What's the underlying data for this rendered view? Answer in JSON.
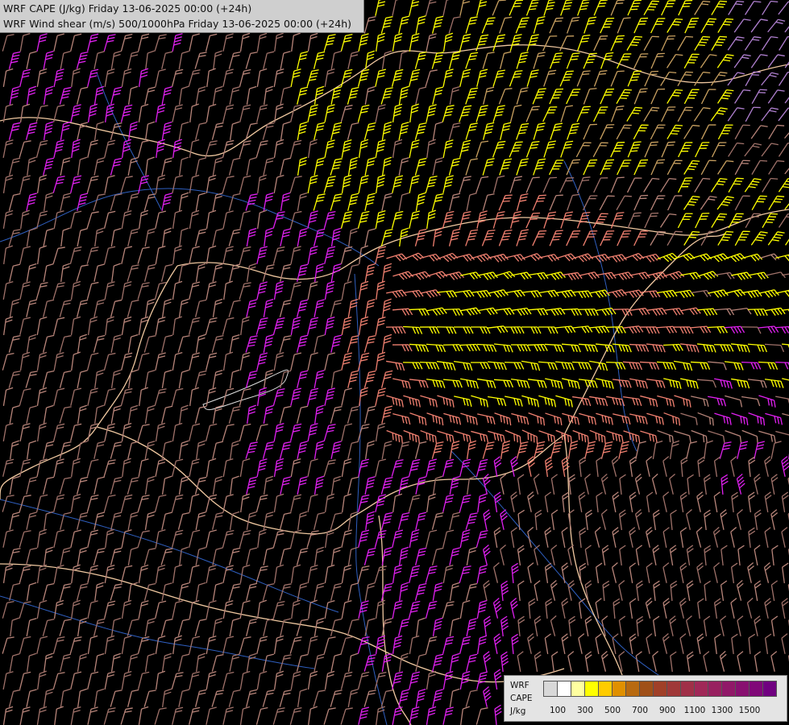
{
  "header": {
    "title_line1": "WRF CAPE (J/kg) Friday 13-06-2025 00:00 (+24h)",
    "title_line2": "WRF Wind shear (m/s) 500/1000hPa Friday 13-06-2025 00:00 (+24h)"
  },
  "legend": {
    "label_model": "WRF",
    "label_field": "CAPE",
    "label_unit": "J/kg",
    "colors": [
      "#d8d8d8",
      "#ffffff",
      "#ffffa0",
      "#ffff00",
      "#ffcc00",
      "#e09000",
      "#b86a10",
      "#a05018",
      "#a04028",
      "#a03838",
      "#a03048",
      "#a02858",
      "#982060",
      "#901868",
      "#881070",
      "#800878",
      "#700080"
    ],
    "tick_labels": [
      "100",
      "300",
      "500",
      "700",
      "900",
      "1100",
      "1300",
      "1500"
    ]
  },
  "map": {
    "background_color": "#000000",
    "border_color": "#f0c8a0",
    "river_color": "#3060c0",
    "barb_colors": {
      "low_cape": "#b8857a",
      "salmon": "#f08070",
      "magenta": "#e020f0",
      "yellow": "#ffff00",
      "tan": "#c8a060",
      "lilac": "#b080d0"
    }
  }
}
